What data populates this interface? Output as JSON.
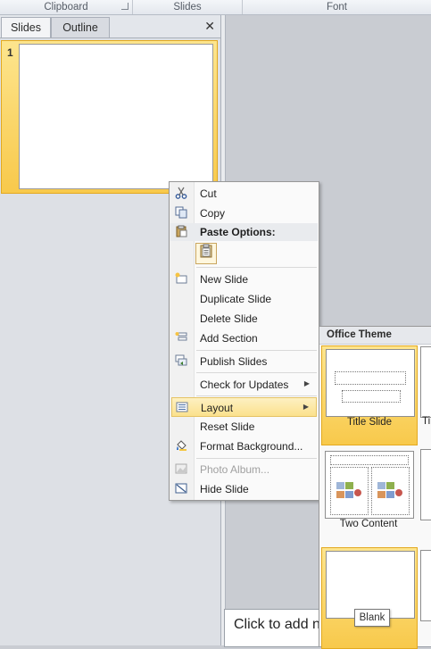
{
  "ribbon": {
    "groups": [
      {
        "label": "Clipboard"
      },
      {
        "label": "Slides"
      },
      {
        "label": "Font"
      }
    ]
  },
  "left_pane": {
    "tabs": [
      {
        "label": "Slides",
        "active": true
      },
      {
        "label": "Outline",
        "active": false
      }
    ],
    "close_glyph": "✕",
    "thumbnails": [
      {
        "number": "1",
        "selected": true
      }
    ]
  },
  "context_menu": {
    "items": [
      {
        "label": "Cut",
        "icon": "scissors-icon"
      },
      {
        "label": "Copy",
        "icon": "copy-icon"
      },
      {
        "label": "New Slide",
        "icon": "new-slide-icon"
      },
      {
        "label": "Duplicate Slide"
      },
      {
        "label": "Delete Slide"
      },
      {
        "label": "Add Section",
        "icon": "add-section-icon"
      },
      {
        "label": "Publish Slides",
        "icon": "publish-icon"
      },
      {
        "label": "Check for Updates",
        "submenu": true
      },
      {
        "label": "Layout",
        "icon": "layout-icon",
        "submenu": true,
        "highlighted": true
      },
      {
        "label": "Reset Slide"
      },
      {
        "label": "Format Background...",
        "icon": "paint-bucket-icon"
      },
      {
        "label": "Photo Album...",
        "icon": "photo-album-icon",
        "disabled": true
      },
      {
        "label": "Hide Slide",
        "icon": "hide-slide-icon"
      }
    ],
    "paste_options_label": "Paste Options:"
  },
  "layout_flyout": {
    "header": "Office Theme",
    "layouts": [
      {
        "name": "Title Slide",
        "selected": true
      },
      {
        "name": "Two Content",
        "selected": false
      },
      {
        "name": "Blank",
        "selected": true
      }
    ],
    "partial_label": "Ti"
  },
  "tooltip": "Blank",
  "notes_placeholder": "Click to add n",
  "colors": {
    "selection_gold": "#f8c94b",
    "menu_highlight": "#fbe18c",
    "pane_bg": "#dde0e5"
  }
}
